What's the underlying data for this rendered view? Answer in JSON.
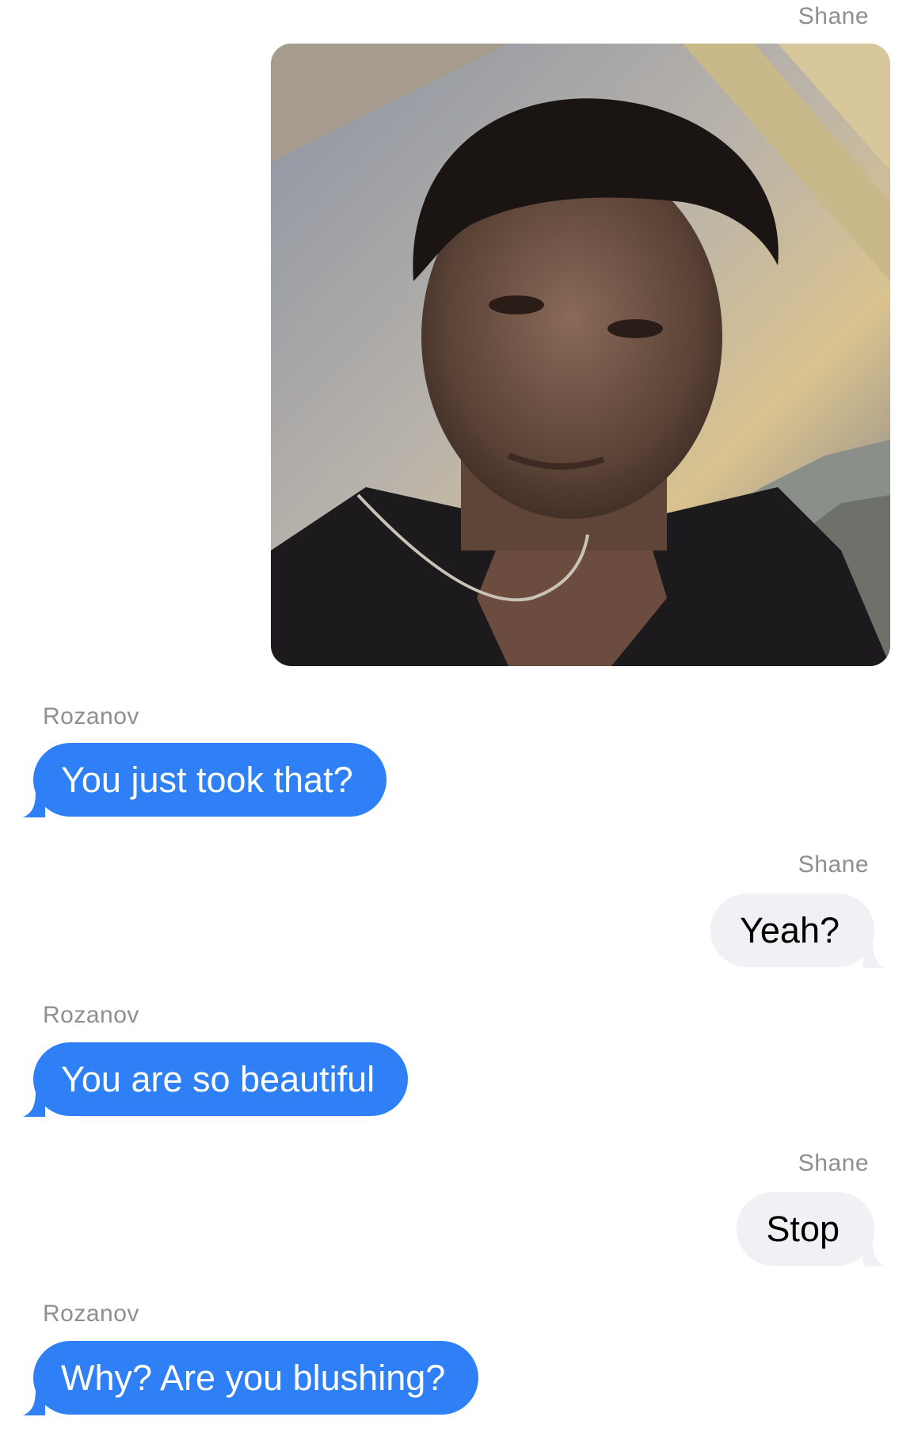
{
  "messages": [
    {
      "sender": "Shane",
      "type": "photo",
      "description_icon": "photo-attachment"
    },
    {
      "sender": "Rozanov",
      "text": "You just took that?"
    },
    {
      "sender": "Shane",
      "text": "Yeah?"
    },
    {
      "sender": "Rozanov",
      "text": "You are so beautiful"
    },
    {
      "sender": "Shane",
      "text": "Stop"
    },
    {
      "sender": "Rozanov",
      "text": "Why? Are you blushing?"
    }
  ],
  "colors": {
    "incoming_bubble": "#2f80f6",
    "outgoing_bubble": "#f0f0f5",
    "sender_label": "#8e8e93"
  }
}
